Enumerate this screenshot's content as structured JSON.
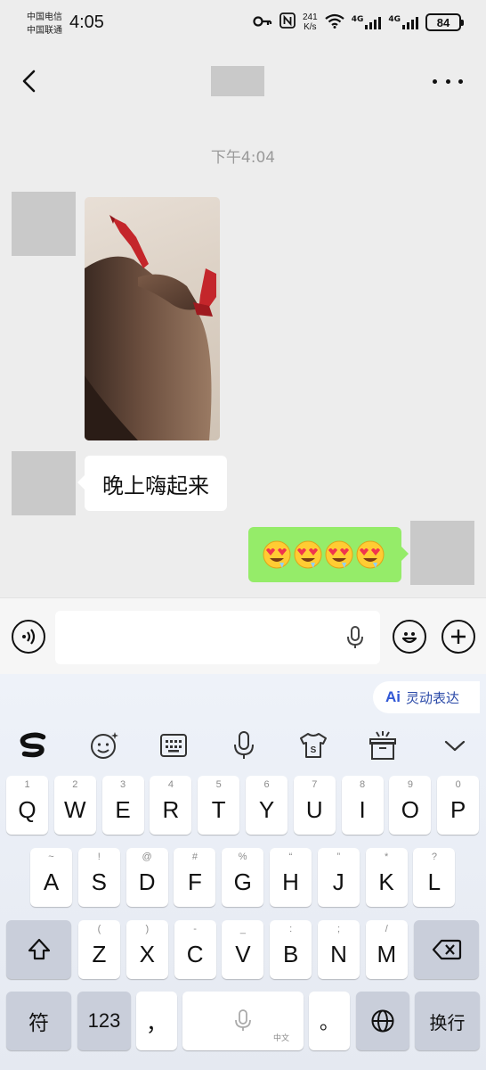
{
  "status_bar": {
    "carrier_1": "中国电信",
    "carrier_2": "中国联通",
    "time": "4:05",
    "net_speed_value": "241",
    "net_speed_unit": "K/s",
    "sim1_label": "4G",
    "sim2_label": "4G",
    "battery": "84"
  },
  "title_bar": {
    "back_icon": "chevron-left-icon",
    "more_icon": "more-horizontal-icon"
  },
  "chat": {
    "timestamp": "下午4:04",
    "messages": [
      {
        "from": "other",
        "type": "image"
      },
      {
        "from": "other",
        "type": "text",
        "text": "晚上嗨起来"
      },
      {
        "from": "me",
        "type": "emoji",
        "text": "😍😍😍😍"
      }
    ],
    "colors": {
      "incoming_bubble": "#ffffff",
      "outgoing_bubble": "#95ec69",
      "avatar_placeholder": "#c9c9c9"
    }
  },
  "input_bar": {
    "voice_icon": "voice-mode-icon",
    "mic_icon": "microphone-icon",
    "emoji_icon": "emoji-icon",
    "plus_icon": "plus-icon",
    "value": ""
  },
  "keyboard": {
    "ai_chip": {
      "logo": "Ai",
      "label": "灵动表达"
    },
    "toolbar": [
      "s-logo-icon",
      "emoji-sparkle-icon",
      "keyboard-icon",
      "microphone-icon",
      "tshirt-skin-icon",
      "gift-box-icon",
      "chevron-down-icon"
    ],
    "row1": [
      {
        "hint": "1",
        "key": "Q"
      },
      {
        "hint": "2",
        "key": "W"
      },
      {
        "hint": "3",
        "key": "E"
      },
      {
        "hint": "4",
        "key": "R"
      },
      {
        "hint": "5",
        "key": "T"
      },
      {
        "hint": "6",
        "key": "Y"
      },
      {
        "hint": "7",
        "key": "U"
      },
      {
        "hint": "8",
        "key": "I"
      },
      {
        "hint": "9",
        "key": "O"
      },
      {
        "hint": "0",
        "key": "P"
      }
    ],
    "row2": [
      {
        "hint": "~",
        "key": "A"
      },
      {
        "hint": "!",
        "key": "S"
      },
      {
        "hint": "@",
        "key": "D"
      },
      {
        "hint": "#",
        "key": "F"
      },
      {
        "hint": "%",
        "key": "G"
      },
      {
        "hint": "“",
        "key": "H"
      },
      {
        "hint": "”",
        "key": "J"
      },
      {
        "hint": "*",
        "key": "K"
      },
      {
        "hint": "?",
        "key": "L"
      }
    ],
    "row3": [
      {
        "hint": "(",
        "key": "Z"
      },
      {
        "hint": ")",
        "key": "X"
      },
      {
        "hint": "-",
        "key": "C"
      },
      {
        "hint": "_",
        "key": "V"
      },
      {
        "hint": ":",
        "key": "B"
      },
      {
        "hint": ";",
        "key": "N"
      },
      {
        "hint": "/",
        "key": "M"
      }
    ],
    "shift_icon": "shift-arrow-icon",
    "backspace_icon": "backspace-icon",
    "symbols_key": "符",
    "numbers_key": "123",
    "comma_key": "，",
    "space_sub": "中文",
    "period_key": "。",
    "globe_icon": "globe-icon",
    "enter_key": "换行"
  }
}
